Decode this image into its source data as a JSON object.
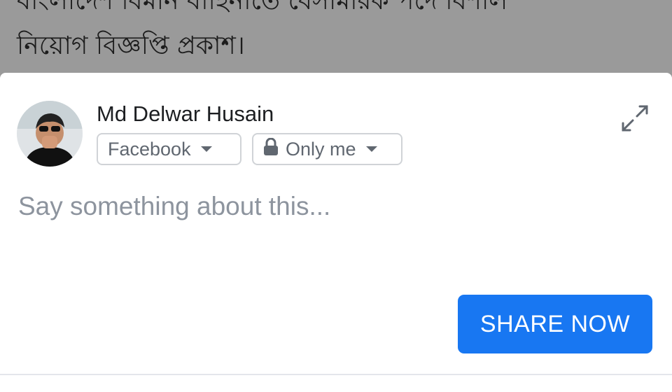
{
  "background_post": {
    "headline_line1": "বাংলাদেশ বিমান বাহিনীতে বেসামরিক পদে বিশাল",
    "headline_line2": "নিয়োগ বিজ্ঞপ্তি প্রকাশ।"
  },
  "share_sheet": {
    "user_name": "Md Delwar Husain",
    "destination": {
      "label": "Facebook",
      "icon": "chevron-down-icon"
    },
    "audience": {
      "label": "Only me",
      "icon": "lock-icon"
    },
    "expand_icon": "expand-icon",
    "compose_placeholder": "Say something about this...",
    "share_button_label": "SHARE NOW"
  },
  "colors": {
    "accent": "#1877f2",
    "overlay": "#9a9a9a",
    "muted_text": "#8d949e"
  }
}
